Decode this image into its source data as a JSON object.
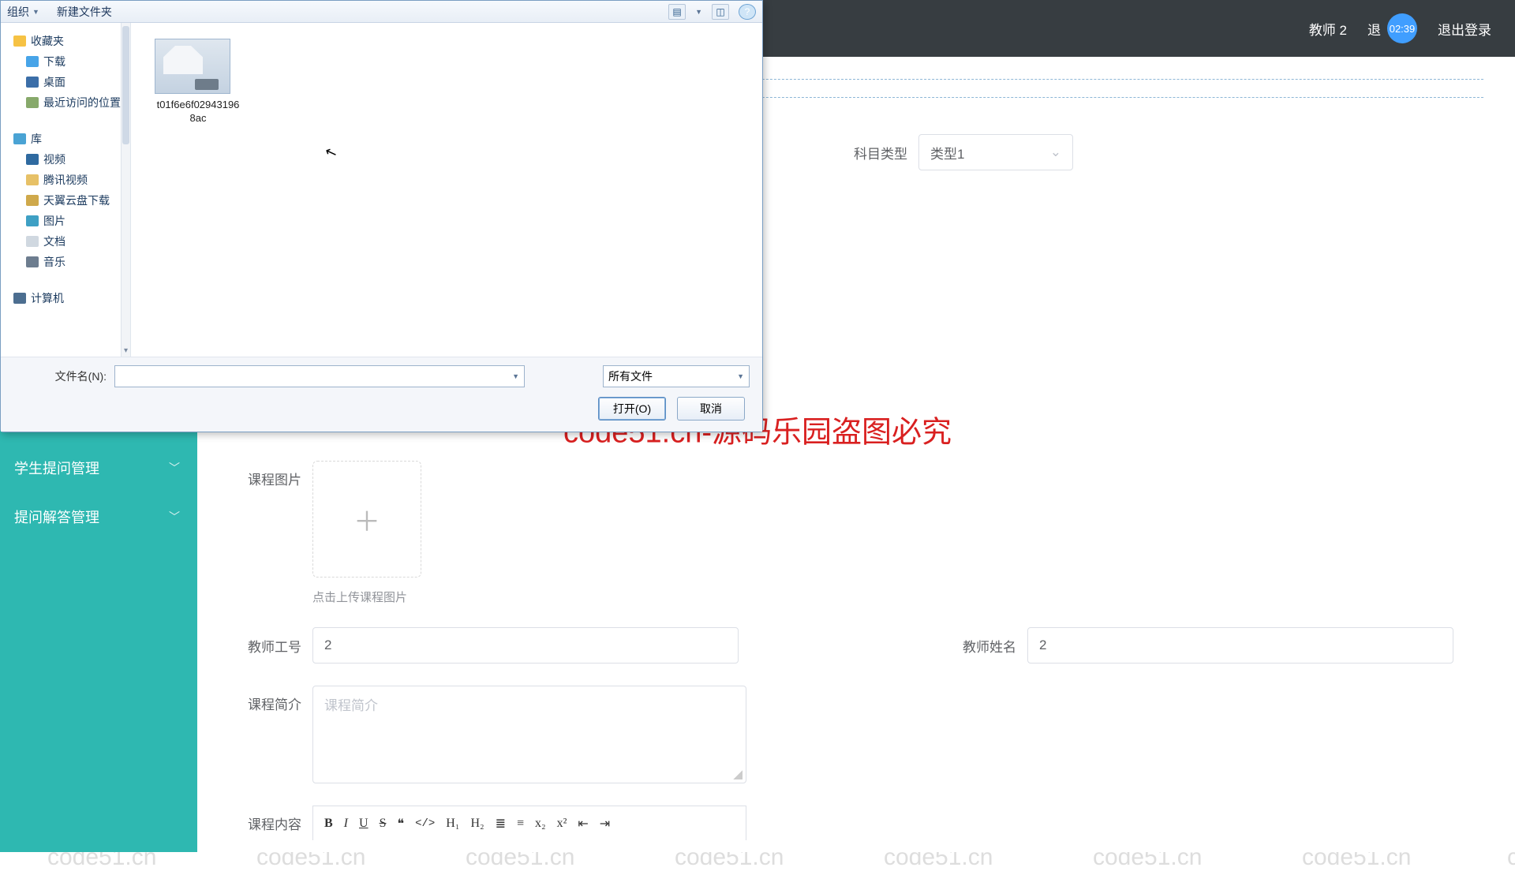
{
  "watermark": "code51.cn",
  "center_watermark": "code51.cn-源码乐园盗图必究",
  "header": {
    "user": "教师 2",
    "back_partial": "退",
    "badge": "02:39",
    "logout": "退出登录"
  },
  "sidebar": {
    "items": [
      {
        "label": "学生提问管理"
      },
      {
        "label": "提问解答管理"
      }
    ]
  },
  "form": {
    "subject_type_label": "科目类型",
    "subject_type_value": "类型1",
    "course_image_label": "课程图片",
    "upload_tip": "点击上传课程图片",
    "teacher_id_label": "教师工号",
    "teacher_id_value": "2",
    "teacher_name_label": "教师姓名",
    "teacher_name_value": "2",
    "course_intro_label": "课程简介",
    "course_intro_placeholder": "课程简介",
    "course_content_label": "课程内容",
    "editor_buttons": {
      "bold": "B",
      "italic": "I",
      "underline": "U",
      "strike": "S",
      "quote": "❝",
      "code": "</>",
      "h1": "H₁",
      "h2": "H₂",
      "ol": "≣",
      "ul": "≡",
      "sub": "x₂",
      "sup": "x²",
      "indent_dec": "⇤",
      "indent_inc": "⇥"
    }
  },
  "file_dialog": {
    "organize": "组织",
    "new_folder": "新建文件夹",
    "view_tooltip": "视图",
    "help_tooltip": "帮助",
    "nav": {
      "favorites": "收藏夹",
      "downloads": "下载",
      "desktop": "桌面",
      "recent": "最近访问的位置",
      "library": "库",
      "video": "视频",
      "tencent_video": "腾讯视频",
      "tianyi_download": "天翼云盘下载",
      "pictures": "图片",
      "documents": "文档",
      "music": "音乐",
      "computer": "计算机"
    },
    "file_item_name": "t01f6e6f029431968ac",
    "filename_label": "文件名(N):",
    "filter_value": "所有文件",
    "open_btn": "打开(O)",
    "cancel_btn": "取消"
  }
}
